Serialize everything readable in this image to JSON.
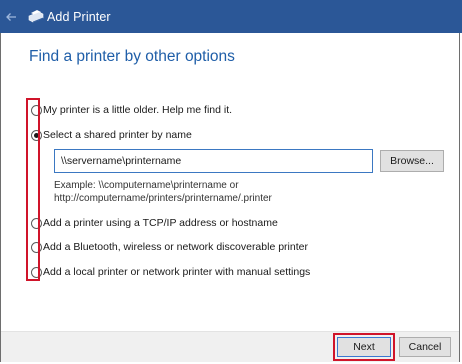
{
  "window": {
    "title": "Add Printer"
  },
  "heading": "Find a printer by other options",
  "options": [
    {
      "label": "My printer is a little older. Help me find it.",
      "checked": false
    },
    {
      "label": "Select a shared printer by name",
      "checked": true
    },
    {
      "label": "Add a printer using a TCP/IP address or hostname",
      "checked": false
    },
    {
      "label": "Add a Bluetooth, wireless or network discoverable printer",
      "checked": false
    },
    {
      "label": "Add a local printer or network printer with manual settings",
      "checked": false
    }
  ],
  "shared_printer": {
    "value": "\\\\servername\\printername",
    "browse_label": "Browse...",
    "example_line1": "Example: \\\\computername\\printername or",
    "example_line2": "http://computername/printers/printername/.printer"
  },
  "footer": {
    "next_label": "Next",
    "cancel_label": "Cancel"
  },
  "colors": {
    "titlebar": "#2b5797",
    "heading": "#1f5ea8",
    "highlight": "#d0142a",
    "input_border": "#3b78c2"
  },
  "icons": {
    "back": "back-arrow-icon",
    "app": "printer-icon"
  }
}
